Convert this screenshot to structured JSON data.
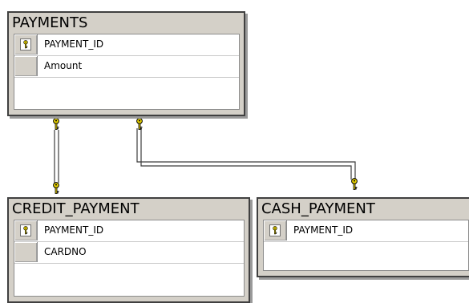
{
  "tables": {
    "payments": {
      "name": "PAYMENTS",
      "columns": [
        {
          "name": "PAYMENT_ID",
          "primary_key": true
        },
        {
          "name": "Amount",
          "primary_key": false
        }
      ]
    },
    "credit_payment": {
      "name": "CREDIT_PAYMENT",
      "columns": [
        {
          "name": "PAYMENT_ID",
          "primary_key": true
        },
        {
          "name": "CARDNO",
          "primary_key": false
        }
      ]
    },
    "cash_payment": {
      "name": "CASH_PAYMENT",
      "columns": [
        {
          "name": "PAYMENT_ID",
          "primary_key": true
        }
      ]
    }
  },
  "relationships": [
    {
      "from": "PAYMENTS",
      "to": "CREDIT_PAYMENT",
      "type": "one-to-one"
    },
    {
      "from": "PAYMENTS",
      "to": "CASH_PAYMENT",
      "type": "one-to-one"
    }
  ],
  "colors": {
    "table_background": "#d4d0c8",
    "table_border": "#404040",
    "grid_background": "#ffffff",
    "key_gold": "#e8d200",
    "connector_line": "#3c3c3c"
  },
  "icons": {
    "primary_key": "key-icon",
    "relationship_end": "key-icon"
  }
}
